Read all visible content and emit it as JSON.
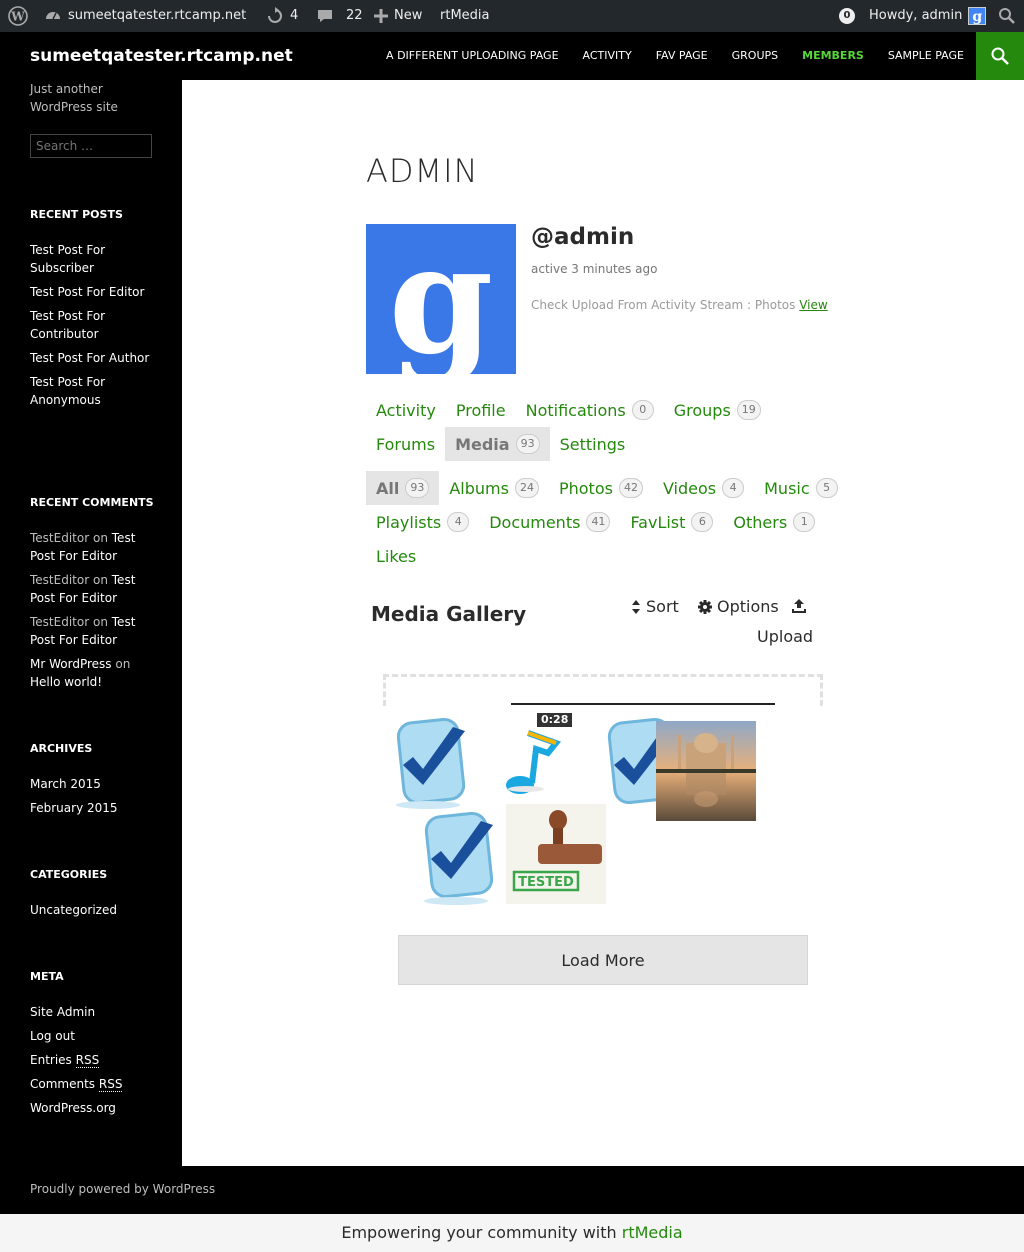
{
  "admin_bar": {
    "site_name": "sumeetqatester.rtcamp.net",
    "updates_count": "4",
    "comments_count": "22",
    "new_label": "New",
    "rtmedia_label": "rtMedia",
    "notification_count": "0",
    "howdy_text": "Howdy, admin"
  },
  "header": {
    "site_title": "sumeetqatester.rtcamp.net",
    "nav": [
      {
        "label": "A Different Uploading Page"
      },
      {
        "label": "Activity"
      },
      {
        "label": "Fav Page"
      },
      {
        "label": "Groups"
      },
      {
        "label": "Members",
        "current": true
      },
      {
        "label": "Sample Page"
      }
    ]
  },
  "sidebar": {
    "tagline": "Just another WordPress site",
    "search_placeholder": "Search …",
    "recent_posts": {
      "title": "Recent Posts",
      "items": [
        "Test Post For Subscriber",
        "Test Post For Editor",
        "Test Post For Contributor",
        "Test Post For Author",
        "Test Post For Anonymous"
      ]
    },
    "recent_comments": {
      "title": "Recent Comments",
      "items": [
        {
          "author": "TestEditor",
          "on": "on",
          "post": "Test Post For Editor"
        },
        {
          "author": "TestEditor",
          "on": "on",
          "post": "Test Post For Editor"
        },
        {
          "author": "TestEditor",
          "on": "on",
          "post": "Test Post For Editor"
        },
        {
          "author": "Mr WordPress",
          "on": "on",
          "post": "Hello world!"
        }
      ]
    },
    "archives": {
      "title": "Archives",
      "items": [
        "March 2015",
        "February 2015"
      ]
    },
    "categories": {
      "title": "Categories",
      "items": [
        "Uncategorized"
      ]
    },
    "meta": {
      "title": "Meta",
      "site_admin": "Site Admin",
      "log_out": "Log out",
      "entries_prefix": "Entries",
      "comments_prefix": "Comments",
      "rss": "RSS",
      "wordpress_org": "WordPress.org"
    }
  },
  "profile": {
    "page_title": "ADMIN",
    "username": "@admin",
    "last_active": "active 3 minutes ago",
    "latest_update": "Check Upload From Activity Stream : Photos",
    "view_link": "View",
    "nav_row1": [
      {
        "label": "Activity"
      },
      {
        "label": "Profile"
      },
      {
        "label": "Notifications",
        "count": "0"
      },
      {
        "label": "Groups",
        "count": "19"
      }
    ],
    "nav_row2": [
      {
        "label": "Forums"
      },
      {
        "label": "Media",
        "count": "93",
        "selected": true
      },
      {
        "label": "Settings"
      }
    ]
  },
  "media_tabs": {
    "row1": [
      {
        "label": "All",
        "count": "93",
        "selected": true
      },
      {
        "label": "Albums",
        "count": "24"
      },
      {
        "label": "Photos",
        "count": "42"
      },
      {
        "label": "Videos",
        "count": "4"
      },
      {
        "label": "Music",
        "count": "5"
      }
    ],
    "row2": [
      {
        "label": "Playlists",
        "count": "4"
      },
      {
        "label": "Documents",
        "count": "41"
      },
      {
        "label": "FavList",
        "count": "6"
      },
      {
        "label": "Others",
        "count": "1"
      }
    ],
    "row3": [
      {
        "label": "Likes"
      }
    ]
  },
  "gallery": {
    "title": "Media Gallery",
    "sort_label": "Sort",
    "options_label": "Options",
    "upload_label": "Upload",
    "video_duration": "0:28",
    "tested_stamp_text": "TESTED",
    "load_more": "Load More"
  },
  "footer": {
    "credit": "Proudly powered by WordPress",
    "rtmedia_prefix": "Empowering your community with",
    "rtmedia_link": "rtMedia"
  },
  "colors": {
    "accent_green": "#24890d",
    "nav_current": "#55d737",
    "admin_bar_bg": "#23282d",
    "avatar_blue": "#3b78e7"
  }
}
